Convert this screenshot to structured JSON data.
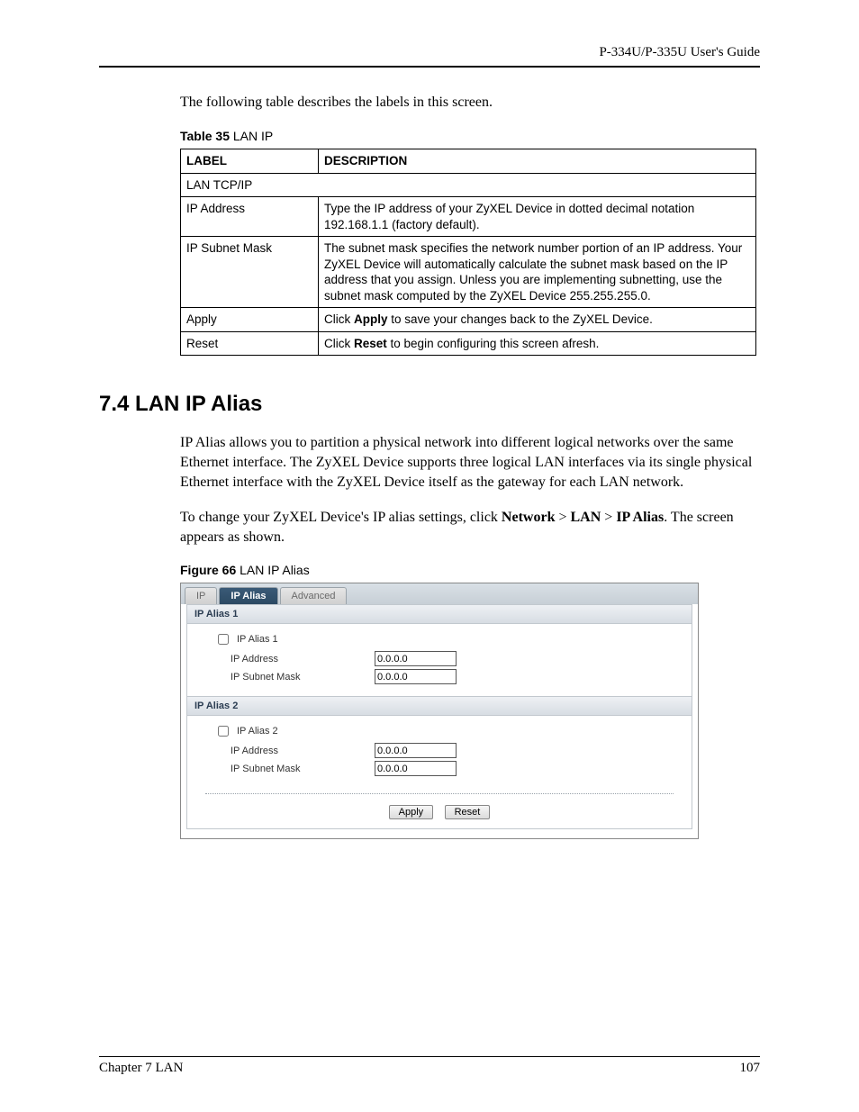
{
  "header": {
    "guide_title": "P-334U/P-335U User's Guide"
  },
  "intro": "The following table describes the labels in this screen.",
  "table_caption": {
    "bold": "Table 35",
    "rest": "   LAN IP"
  },
  "table": {
    "headers": {
      "label": "LABEL",
      "description": "DESCRIPTION"
    },
    "rows": [
      {
        "label": "LAN TCP/IP",
        "description": "",
        "span": true
      },
      {
        "label": "IP Address",
        "description": "Type the IP address of your ZyXEL Device in dotted decimal notation 192.168.1.1 (factory default)."
      },
      {
        "label": "IP Subnet Mask",
        "description": "The subnet mask specifies the network number portion of an IP address. Your ZyXEL Device will automatically calculate the subnet mask based on the IP address that you assign. Unless you are implementing subnetting, use the subnet mask computed by the ZyXEL Device 255.255.255.0."
      },
      {
        "label": "Apply",
        "description_pre": "Click ",
        "description_bold": "Apply",
        "description_post": " to save your changes back to the ZyXEL Device."
      },
      {
        "label": "Reset",
        "description_pre": "Click ",
        "description_bold": "Reset",
        "description_post": " to begin configuring this screen afresh."
      }
    ]
  },
  "section": {
    "heading": "7.4  LAN IP Alias",
    "para1": "IP Alias allows you to partition a physical network into different logical networks over the same Ethernet interface. The ZyXEL Device supports three logical LAN interfaces via its single physical Ethernet interface with the ZyXEL Device itself as the gateway for each LAN network.",
    "para2_pre": "To change your ZyXEL Device's IP alias settings, click ",
    "para2_b1": "Network",
    "para2_sep": " > ",
    "para2_b2": "LAN",
    "para2_b3": "IP Alias",
    "para2_post": ". The screen appears as shown."
  },
  "figure_caption": {
    "bold": "Figure 66",
    "rest": "   LAN IP Alias"
  },
  "figure": {
    "tabs": {
      "ip": "IP",
      "alias": "IP Alias",
      "advanced": "Advanced"
    },
    "section1": {
      "title": "IP Alias 1",
      "checkbox_label": "IP Alias 1",
      "ip_label": "IP Address",
      "ip_value": "0.0.0.0",
      "mask_label": "IP Subnet Mask",
      "mask_value": "0.0.0.0"
    },
    "section2": {
      "title": "IP Alias 2",
      "checkbox_label": "IP Alias 2",
      "ip_label": "IP Address",
      "ip_value": "0.0.0.0",
      "mask_label": "IP Subnet Mask",
      "mask_value": "0.0.0.0"
    },
    "buttons": {
      "apply": "Apply",
      "reset": "Reset"
    }
  },
  "footer": {
    "chapter": "Chapter 7 LAN",
    "page": "107"
  }
}
